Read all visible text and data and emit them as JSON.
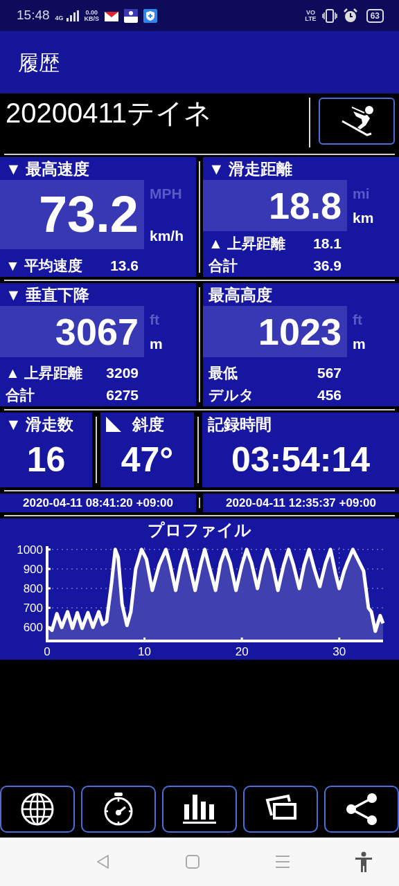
{
  "status_bar": {
    "time": "15:48",
    "network": "4G",
    "speed": "0.00",
    "speed_unit": "KB/S",
    "volte": [
      "VO",
      "LTE"
    ],
    "battery": "63"
  },
  "header": {
    "title": "履歴"
  },
  "session": {
    "name": "20200411テイネ"
  },
  "cards": [
    {
      "label": "▼ 最高速度",
      "value": "73.2",
      "units": [
        {
          "label": "MPH",
          "selected": false
        },
        {
          "label": "km/h",
          "selected": true
        }
      ],
      "rows": [
        {
          "label": "▼ 平均速度",
          "value": "13.6"
        }
      ]
    },
    {
      "label": "▼ 滑走距離",
      "value": "18.8",
      "units": [
        {
          "label": "mi",
          "selected": false
        },
        {
          "label": "km",
          "selected": true
        }
      ],
      "rows": [
        {
          "label": "▲ 上昇距離",
          "value": "18.1"
        },
        {
          "label": "合計",
          "value": "36.9"
        }
      ]
    },
    {
      "label": "▼ 垂直下降",
      "value": "3067",
      "units": [
        {
          "label": "ft",
          "selected": false
        },
        {
          "label": "m",
          "selected": true
        }
      ],
      "rows": [
        {
          "label": "▲ 上昇距離",
          "value": "3209"
        },
        {
          "label": "合計",
          "value": "6275"
        }
      ]
    },
    {
      "label": "最高高度",
      "value": "1023",
      "units": [
        {
          "label": "ft",
          "selected": false
        },
        {
          "label": "m",
          "selected": true
        }
      ],
      "rows": [
        {
          "label": "最低",
          "value": "567"
        },
        {
          "label": "デルタ",
          "value": "456"
        }
      ]
    }
  ],
  "small_cards": [
    {
      "kind": "count",
      "label": "▼ 滑走数",
      "value": "16"
    },
    {
      "kind": "slope",
      "label": "斜度",
      "value": "47°"
    },
    {
      "kind": "time",
      "label": "記録時間",
      "value": "03:54:14"
    }
  ],
  "dates": [
    "2020-04-11 08:41:20 +09:00",
    "2020-04-11 12:35:37 +09:00"
  ],
  "profile": {
    "title": "プロファイル",
    "chart_data": {
      "type": "area",
      "x": [
        0,
        0.3,
        0.5,
        1,
        1.5,
        2.1,
        2.6,
        3.1,
        3.6,
        4.2,
        4.7,
        5.3,
        5.7,
        6.1,
        6.6,
        7,
        7.3,
        7.7,
        8.2,
        8.6,
        9.1,
        9.7,
        10.2,
        10.8,
        11.5,
        12.2,
        12.6,
        13.2,
        13.7,
        14.2,
        14.6,
        15.2,
        15.8,
        16.2,
        16.6,
        17.3,
        17.8,
        18.3,
        18.8,
        19.4,
        20,
        20.5,
        21,
        21.6,
        22.1,
        22.6,
        23.1,
        23.7,
        24.3,
        24.8,
        25.3,
        25.9,
        26.4,
        26.9,
        27.5,
        28,
        28.6,
        29.1,
        29.6,
        30,
        30.5,
        30.8,
        31.4,
        31.9,
        32.5,
        33,
        33.3,
        33.7,
        34.2,
        34.5
      ],
      "values": [
        600,
        595,
        585,
        670,
        600,
        680,
        595,
        675,
        595,
        675,
        600,
        680,
        615,
        630,
        820,
        1000,
        960,
        720,
        610,
        680,
        900,
        1000,
        950,
        790,
        920,
        1000,
        930,
        790,
        920,
        1000,
        920,
        790,
        930,
        1000,
        920,
        790,
        930,
        1000,
        930,
        790,
        920,
        1000,
        930,
        800,
        920,
        1000,
        930,
        790,
        920,
        1000,
        920,
        800,
        920,
        1000,
        890,
        810,
        930,
        1000,
        880,
        800,
        890,
        930,
        1000,
        950,
        890,
        700,
        680,
        580,
        660,
        620
      ],
      "xlim": [
        0,
        34.5
      ],
      "ylim": [
        530,
        1010
      ],
      "xticks": [
        0,
        10,
        20,
        30
      ],
      "yticks": [
        600,
        700,
        800,
        900,
        1000
      ],
      "grid": true
    }
  },
  "toolbar": [
    {
      "kind": "globe"
    },
    {
      "kind": "stopwatch"
    },
    {
      "kind": "bars"
    },
    {
      "kind": "photos"
    },
    {
      "kind": "share"
    }
  ]
}
